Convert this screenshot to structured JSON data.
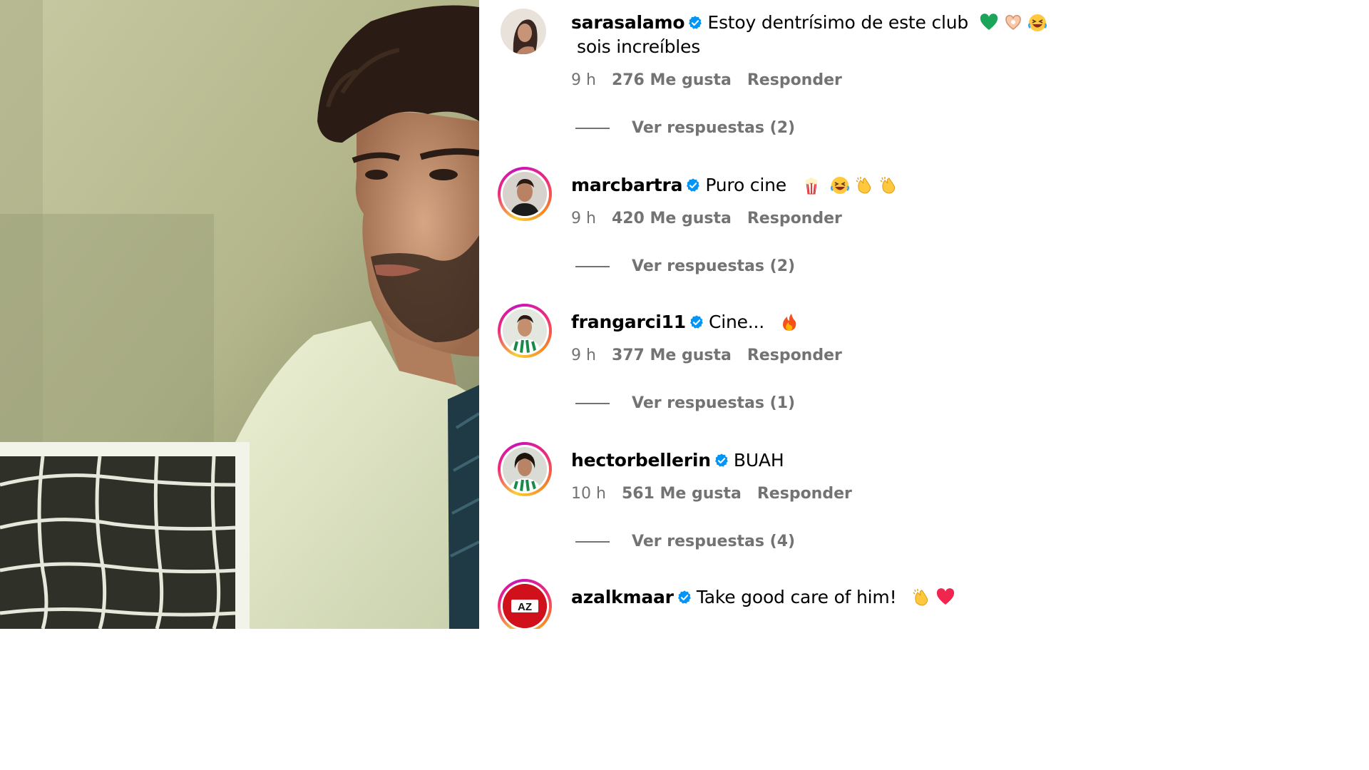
{
  "comments": [
    {
      "username": "sarasalamo",
      "text": "Estoy dentrísimo de este club",
      "text_tail": "sois increíbles",
      "emojis": [
        "green-heart-icon",
        "heart-hands-icon",
        "laughing-face-icon"
      ],
      "time": "9 h",
      "likes": "276 Me gusta",
      "reply_label": "Responder",
      "view_replies": "Ver respuestas (2)"
    },
    {
      "username": "marcbartra",
      "text": "Puro cine",
      "emojis": [
        "popcorn-icon",
        "laughing-face-icon",
        "clapping-hands-icon",
        "clapping-hands-icon"
      ],
      "time": "9 h",
      "likes": "420 Me gusta",
      "reply_label": "Responder",
      "view_replies": "Ver respuestas (2)"
    },
    {
      "username": "frangarci11",
      "text": "Cine...",
      "emojis": [
        "fire-icon"
      ],
      "time": "9 h",
      "likes": "377 Me gusta",
      "reply_label": "Responder",
      "view_replies": "Ver respuestas (1)"
    },
    {
      "username": "hectorbellerin",
      "text": "BUAH",
      "emojis": [],
      "time": "10 h",
      "likes": "561 Me gusta",
      "reply_label": "Responder",
      "view_replies": "Ver respuestas (4)"
    },
    {
      "username": "azalkmaar",
      "text": "Take good care of him!",
      "emojis": [
        "clapping-hands-icon",
        "red-heart-icon"
      ],
      "avatar_text": "AZ"
    }
  ],
  "colors": {
    "verified": "#0095f6",
    "meta_text": "#737373",
    "story_ring": "#ee2a7b"
  }
}
